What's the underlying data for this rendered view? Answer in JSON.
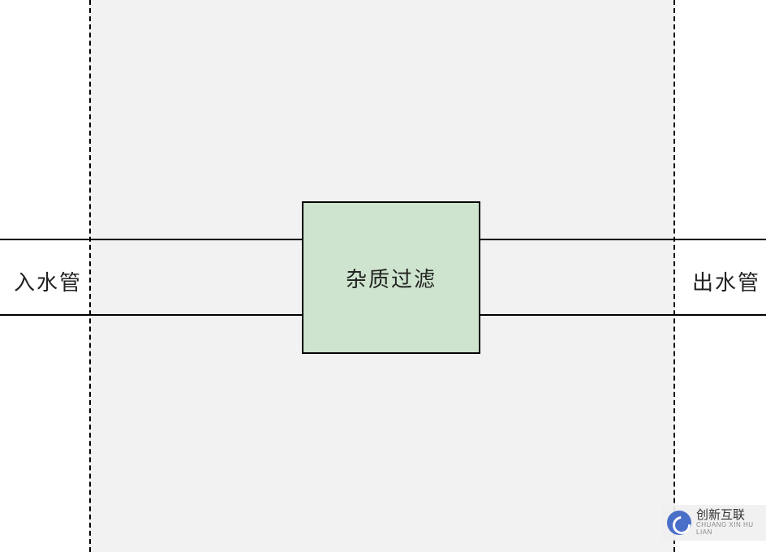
{
  "diagram": {
    "inlet_label": "入水管",
    "outlet_label": "出水管",
    "filter_label": "杂质过滤"
  },
  "watermark": {
    "title": "创新互联",
    "subtitle": "CHUANG XIN HU LIAN"
  }
}
